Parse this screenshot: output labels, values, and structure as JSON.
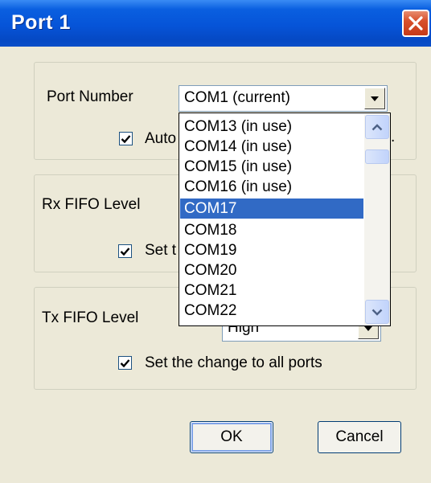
{
  "window": {
    "title": "Port 1"
  },
  "port_group": {
    "port_number_label": "Port Number",
    "port_number_value": "COM1 (current)",
    "auto_checkbox_label": "Auto",
    "auto_checked": true,
    "right_partial_text": "."
  },
  "rx_group": {
    "label": "Rx FIFO Level",
    "set_checkbox_label": "Set t",
    "set_checked": true
  },
  "tx_group": {
    "label": "Tx FIFO Level",
    "value_partial": "High",
    "set_checkbox_label": "Set the change to all ports",
    "set_checked": true
  },
  "dropdown": {
    "items": [
      "COM13 (in use)",
      "COM14 (in use)",
      "COM15 (in use)",
      "COM16 (in use)",
      "COM17",
      "COM18",
      "COM19",
      "COM20",
      "COM21",
      "COM22"
    ],
    "selected_index": 4
  },
  "buttons": {
    "ok": "OK",
    "cancel": "Cancel"
  },
  "colors": {
    "titlebar": "#0654d8",
    "selection": "#316ac5",
    "dialog_bg": "#ece9d8"
  }
}
